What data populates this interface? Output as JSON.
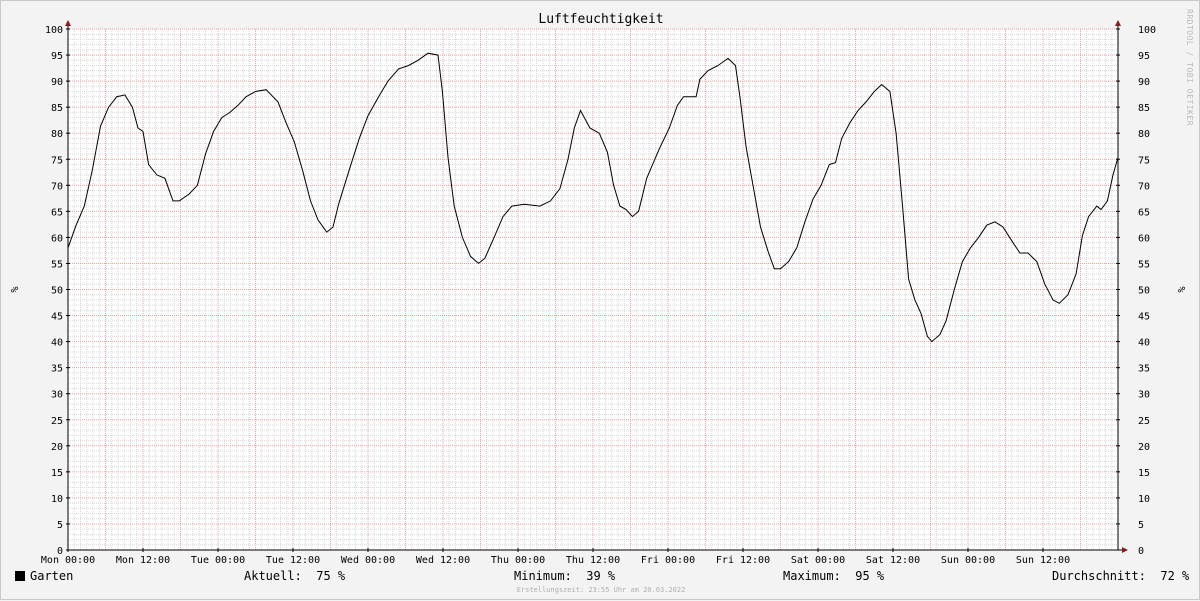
{
  "chart_data": {
    "type": "line",
    "title": "Luftfeuchtigkeit",
    "ylabel": "%",
    "ylabel_right": "%",
    "ylim": [
      0,
      100
    ],
    "yticks": [
      0,
      5,
      10,
      15,
      20,
      25,
      30,
      35,
      40,
      45,
      50,
      55,
      60,
      65,
      70,
      75,
      80,
      85,
      90,
      95,
      100
    ],
    "x_range_hours": [
      0,
      168
    ],
    "x_ticks": [
      {
        "hour": 0,
        "label": "Mon 00:00"
      },
      {
        "hour": 12,
        "label": "Mon 12:00"
      },
      {
        "hour": 24,
        "label": "Tue 00:00"
      },
      {
        "hour": 36,
        "label": "Tue 12:00"
      },
      {
        "hour": 48,
        "label": "Wed 00:00"
      },
      {
        "hour": 60,
        "label": "Wed 12:00"
      },
      {
        "hour": 72,
        "label": "Thu 00:00"
      },
      {
        "hour": 84,
        "label": "Thu 12:00"
      },
      {
        "hour": 96,
        "label": "Fri 00:00"
      },
      {
        "hour": 108,
        "label": "Fri 12:00"
      },
      {
        "hour": 120,
        "label": "Sat 00:00"
      },
      {
        "hour": 132,
        "label": "Sat 12:00"
      },
      {
        "hour": 144,
        "label": "Sun 00:00"
      },
      {
        "hour": 156,
        "label": "Sun 12:00"
      }
    ],
    "grid": true,
    "series": [
      {
        "name": "Garten",
        "color": "#000000",
        "points": [
          [
            0,
            58
          ],
          [
            1.3,
            62
          ],
          [
            2.6,
            66
          ],
          [
            3.9,
            73
          ],
          [
            5.2,
            81
          ],
          [
            6.5,
            85
          ],
          [
            7.8,
            87
          ],
          [
            9.1,
            87
          ],
          [
            10.3,
            85
          ],
          [
            11.2,
            81
          ],
          [
            12,
            80
          ],
          [
            12.9,
            74
          ],
          [
            14.2,
            72
          ],
          [
            15.5,
            71
          ],
          [
            16.8,
            67
          ],
          [
            17.8,
            67
          ],
          [
            19.4,
            68
          ],
          [
            20.7,
            70
          ],
          [
            22,
            76
          ],
          [
            23.3,
            80
          ],
          [
            24.6,
            83
          ],
          [
            25.9,
            84
          ],
          [
            27.2,
            85
          ],
          [
            28.5,
            87
          ],
          [
            30,
            88
          ],
          [
            31.7,
            88
          ],
          [
            33.6,
            86
          ],
          [
            34.9,
            82
          ],
          [
            36.2,
            78
          ],
          [
            37.5,
            73
          ],
          [
            38.8,
            67
          ],
          [
            40,
            63
          ],
          [
            41.4,
            61
          ],
          [
            42.4,
            62
          ],
          [
            43.3,
            66
          ],
          [
            45,
            73
          ],
          [
            46.6,
            79
          ],
          [
            48,
            83
          ],
          [
            49.7,
            87
          ],
          [
            51.2,
            90
          ],
          [
            52.9,
            92
          ],
          [
            54.5,
            93
          ],
          [
            56,
            94
          ],
          [
            57.6,
            95
          ],
          [
            59.2,
            95
          ],
          [
            59.9,
            88
          ],
          [
            60.8,
            75
          ],
          [
            61.8,
            66
          ],
          [
            63.1,
            60
          ],
          [
            64.4,
            56
          ],
          [
            65.7,
            55
          ],
          [
            66.7,
            56
          ],
          [
            68.3,
            60
          ],
          [
            69.6,
            64
          ],
          [
            71,
            66
          ],
          [
            73,
            66
          ],
          [
            75.5,
            66
          ],
          [
            77.2,
            67
          ],
          [
            78.7,
            69
          ],
          [
            80,
            75
          ],
          [
            81,
            81
          ],
          [
            82,
            84
          ],
          [
            83.5,
            81
          ],
          [
            85,
            80
          ],
          [
            86.3,
            76
          ],
          [
            87.3,
            70
          ],
          [
            88.3,
            66
          ],
          [
            89.3,
            65
          ],
          [
            90.3,
            64
          ],
          [
            91.3,
            65
          ],
          [
            92.6,
            71
          ],
          [
            94.6,
            77
          ],
          [
            96.2,
            81
          ],
          [
            97.5,
            85
          ],
          [
            98.5,
            87
          ],
          [
            100.5,
            87
          ],
          [
            101.1,
            90
          ],
          [
            102.4,
            92
          ],
          [
            104,
            93
          ],
          [
            105.6,
            94
          ],
          [
            106.8,
            93
          ],
          [
            107.5,
            87
          ],
          [
            108.5,
            77
          ],
          [
            109.6,
            70
          ],
          [
            110.8,
            62
          ],
          [
            112,
            57
          ],
          [
            113,
            54
          ],
          [
            114,
            54
          ],
          [
            115.3,
            55
          ],
          [
            116.6,
            58
          ],
          [
            117.9,
            63
          ],
          [
            119.2,
            67
          ],
          [
            120.5,
            70
          ],
          [
            121.8,
            74
          ],
          [
            122.8,
            74
          ],
          [
            123.8,
            79
          ],
          [
            125.1,
            82
          ],
          [
            126.4,
            84
          ],
          [
            127.7,
            86
          ],
          [
            129,
            88
          ],
          [
            130.2,
            89
          ],
          [
            131.5,
            88
          ],
          [
            132.5,
            80
          ],
          [
            133.5,
            66
          ],
          [
            134.5,
            52
          ],
          [
            135.5,
            48
          ],
          [
            136.5,
            45
          ],
          [
            137.5,
            41
          ],
          [
            138.2,
            40
          ],
          [
            139.5,
            41
          ],
          [
            140.5,
            44
          ],
          [
            141.8,
            50
          ],
          [
            143.1,
            55
          ],
          [
            144.4,
            58
          ],
          [
            145.7,
            60
          ],
          [
            147,
            62
          ],
          [
            148.3,
            63
          ],
          [
            149.6,
            62
          ],
          [
            151,
            59
          ],
          [
            152.3,
            57
          ],
          [
            153.6,
            57
          ],
          [
            155,
            55
          ],
          [
            156.3,
            51
          ],
          [
            157.6,
            48
          ],
          [
            158.6,
            47
          ],
          [
            160,
            49
          ],
          [
            161.3,
            53
          ],
          [
            162.3,
            60
          ],
          [
            163.3,
            64
          ],
          [
            164.6,
            66
          ],
          [
            165.3,
            65
          ],
          [
            166.3,
            67
          ],
          [
            167.2,
            72
          ],
          [
            168,
            75
          ]
        ]
      }
    ]
  },
  "watermark": "RRDTOOL / TOBI OETIKER",
  "legend": {
    "series_label": "Garten",
    "aktuell": "Aktuell:  75 %",
    "minimum": "Minimum:  39 %",
    "maximum": "Maximum:  95 %",
    "durchschnitt": "Durchschnitt:  72 %"
  },
  "footer": "Erstellungszeit: 23:55 Uhr am 20.03.2022",
  "colors": {
    "background": "#f3f3f3",
    "canvas": "#ffffff",
    "grid_minor": "#d8d8d8",
    "grid_major": "#e8a0a0",
    "axis": "#000000",
    "arrow": "#8b1a1a",
    "line": "#000000"
  }
}
